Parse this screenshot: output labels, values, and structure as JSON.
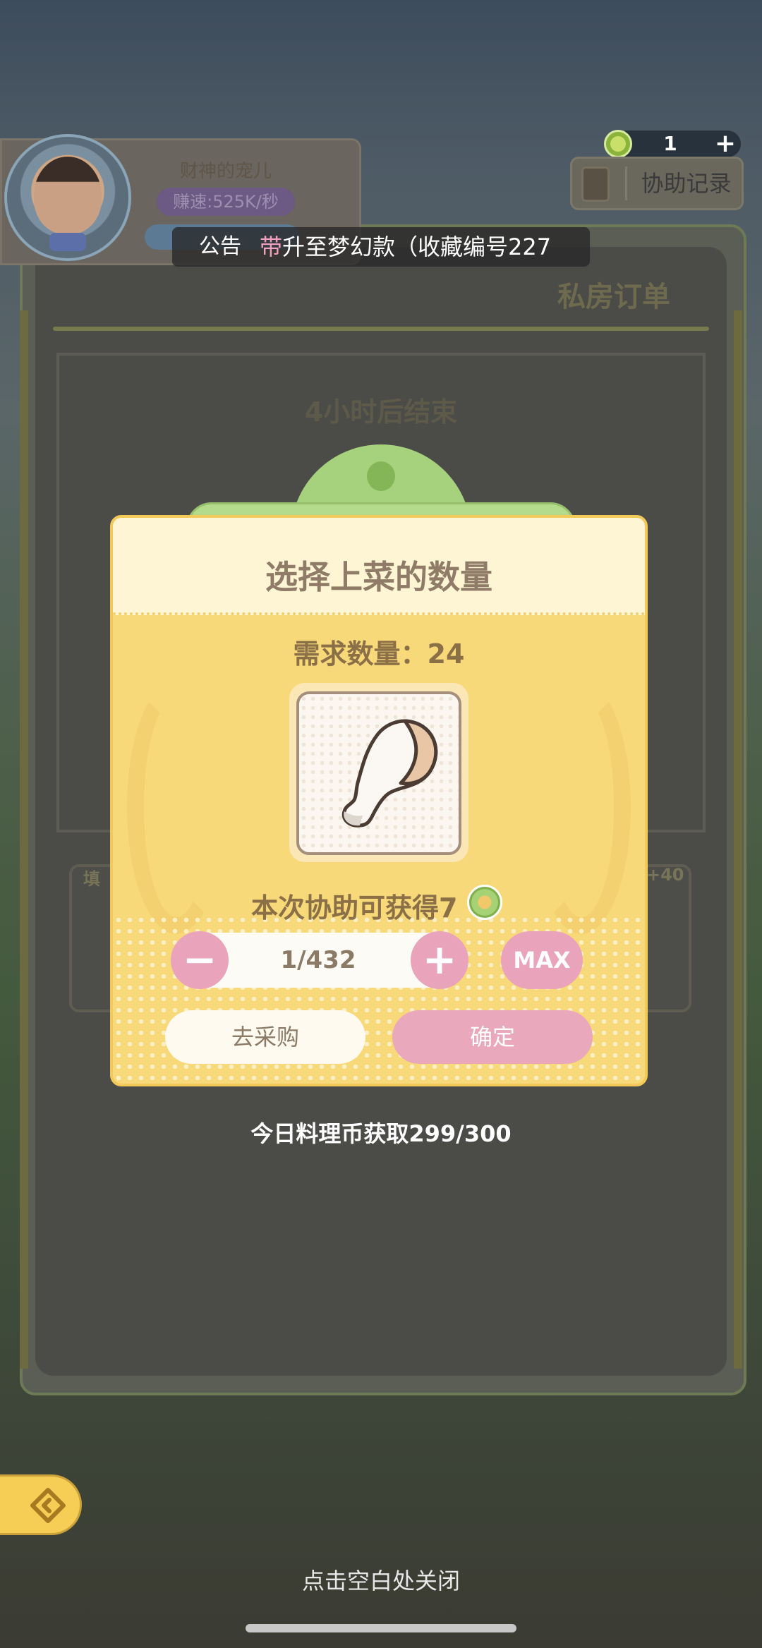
{
  "profile": {
    "name": "财神的宠儿",
    "speed": "赚速:525K/秒"
  },
  "currency": {
    "count": "1",
    "add": "+"
  },
  "assist": {
    "label": "协助记录"
  },
  "announcement": {
    "label": "公告",
    "text_highlight": "带",
    "text_rest": "升至梦幻款（收藏编号227"
  },
  "background": {
    "order_title": "私房订单",
    "timer": "4小时后结束",
    "card_left_label": "填",
    "card_right_label": "+40"
  },
  "modal": {
    "title": "选择上菜的数量",
    "demand": "需求数量：24",
    "item_icon": "drumstick-icon",
    "reward": "本次协助可获得7",
    "quantity": "1/432",
    "minus": "−",
    "plus": "+",
    "max": "MAX",
    "buy": "去采购",
    "confirm": "确定"
  },
  "daily": "今日料理币获取299/300",
  "close_hint": "点击空白处关闭",
  "colors": {
    "accent_pink": "#e9a4bb",
    "modal_yellow": "#f7d97a",
    "tab_green": "#b4da8c"
  }
}
